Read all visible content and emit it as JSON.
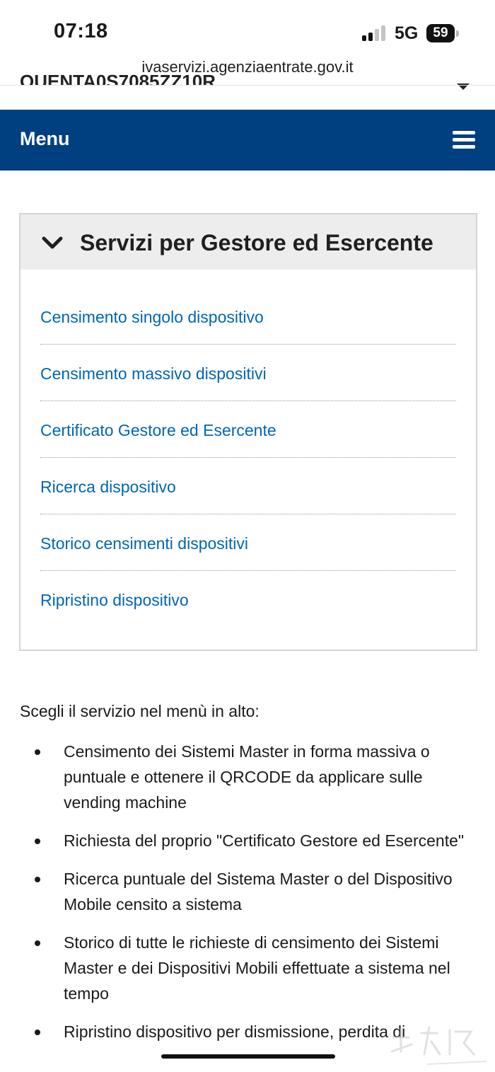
{
  "status_bar": {
    "time": "07:18",
    "network": "5G",
    "battery": "59"
  },
  "browser": {
    "url": "ivaservizi.agenziaentrate.gov.it",
    "partial_text": "QUENTA0S7085ZZ10R"
  },
  "menu_bar": {
    "label": "Menu",
    "background": "#004080"
  },
  "panel": {
    "title": "Servizi per Gestore ed Esercente",
    "links": [
      {
        "label": "Censimento singolo dispositivo"
      },
      {
        "label": "Censimento massivo dispositivi"
      },
      {
        "label": "Certificato Gestore ed Esercente"
      },
      {
        "label": "Ricerca dispositivo"
      },
      {
        "label": "Storico censimenti dispositivi"
      },
      {
        "label": "Ripristino dispositivo"
      }
    ],
    "link_color": "#0066b3"
  },
  "content": {
    "intro": "Scegli il servizio nel menù in alto:",
    "bullets": [
      "Censimento dei Sistemi Master in forma massiva o puntuale e ottenere il QRCODE da applicare sulle vending machine",
      "Richiesta del proprio \"Certificato Gestore ed Esercente\"",
      "Ricerca puntuale del Sistema Master o del Dispositivo Mobile censito a sistema",
      "Storico di tutte le richieste di censimento dei Sistemi Master e dei Dispositivi Mobili effettuate a sistema nel tempo",
      "Ripristino dispositivo per dismissione, perdita di"
    ]
  }
}
